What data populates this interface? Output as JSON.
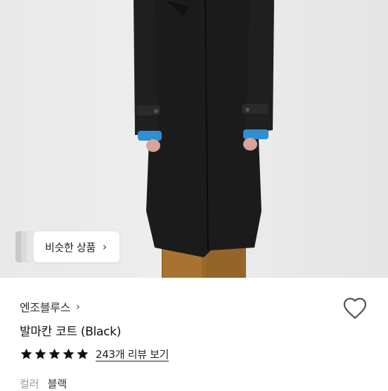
{
  "similar": {
    "label": "비슷한 상품",
    "chevron": "›"
  },
  "product": {
    "brand": "엔조블루스",
    "brand_chevron": "›",
    "title": "발마칸 코트 (Black)",
    "rating": 5,
    "review_link": "243개 리뷰 보기",
    "option_label": "컬러",
    "option_value": "블랙"
  },
  "icons": {
    "heart": "heart-outline-icon",
    "star": "star-icon"
  },
  "colors": {
    "star": "#111111",
    "heart_stroke": "#555555"
  }
}
